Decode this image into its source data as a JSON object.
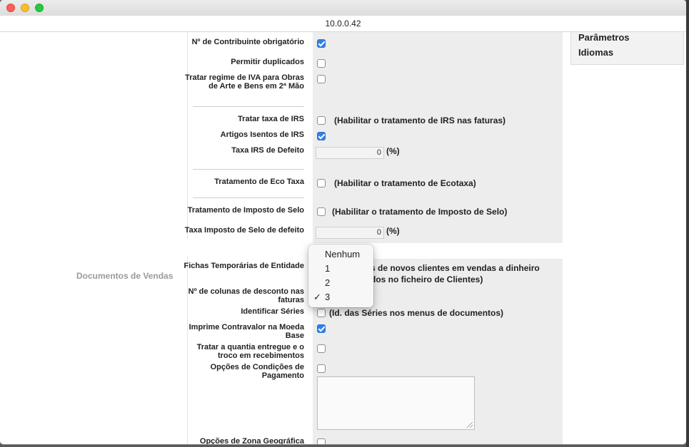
{
  "window": {
    "url": "10.0.0.42"
  },
  "right_panel": {
    "items": [
      "Parâmetros",
      "Idiomas"
    ]
  },
  "section": {
    "title": "Documentos de Vendas"
  },
  "rows": {
    "contribuinte": {
      "label": "Nº de Contribuinte obrigatório",
      "checked": true
    },
    "duplicados": {
      "label": "Permitir duplicados",
      "checked": false
    },
    "iva_obras": {
      "label": "Tratar regime de IVA para Obras de Arte e Bens em 2ª Mão",
      "checked": false
    },
    "taxa_irs": {
      "label": "Tratar taxa de IRS",
      "checked": false,
      "note": "(Habilitar o tratamento de IRS nas faturas)"
    },
    "isentos_irs": {
      "label": "Artigos Isentos de IRS",
      "checked": true
    },
    "irs_defeito": {
      "label": "Taxa IRS de Defeito",
      "value": "0",
      "unit": "(%)"
    },
    "eco_taxa": {
      "label": "Tratamento de Eco Taxa",
      "checked": false,
      "note": "(Habilitar o tratamento de Ecotaxa)"
    },
    "imposto_selo": {
      "label": "Tratamento de Imposto de Selo",
      "checked": false,
      "note": "(Habilitar o tratamento de Imposto de Selo)"
    },
    "selo_defeito": {
      "label": "Taxa Imposto de Selo de defeito",
      "value": "0",
      "unit": "(%)"
    },
    "fichas_temp": {
      "label": "Fichas Temporárias de Entidade",
      "note1": "s de novos clientes em vendas a dinheiro",
      "note2": "dos no ficheiro de Clientes)"
    },
    "colunas_desconto": {
      "label": "Nº de colunas de desconto nas faturas"
    },
    "series": {
      "label": "Identificar Séries",
      "checked": false,
      "note": "(Id. das Séries nos menus de documentos)"
    },
    "contravalor": {
      "label": "Imprime Contravalor na Moeda Base",
      "checked": true
    },
    "quantia": {
      "label": "Tratar a quantia entregue e o troco em recebimentos",
      "checked": false
    },
    "condicoes": {
      "label": "Opções de Condições de Pagamento",
      "checked": false
    },
    "zona": {
      "label": "Opções de Zona Geográfica",
      "checked": false
    }
  },
  "dropdown": {
    "options": [
      "Nenhum",
      "1",
      "2",
      "3"
    ],
    "selected": "3",
    "check_glyph": "✓"
  }
}
